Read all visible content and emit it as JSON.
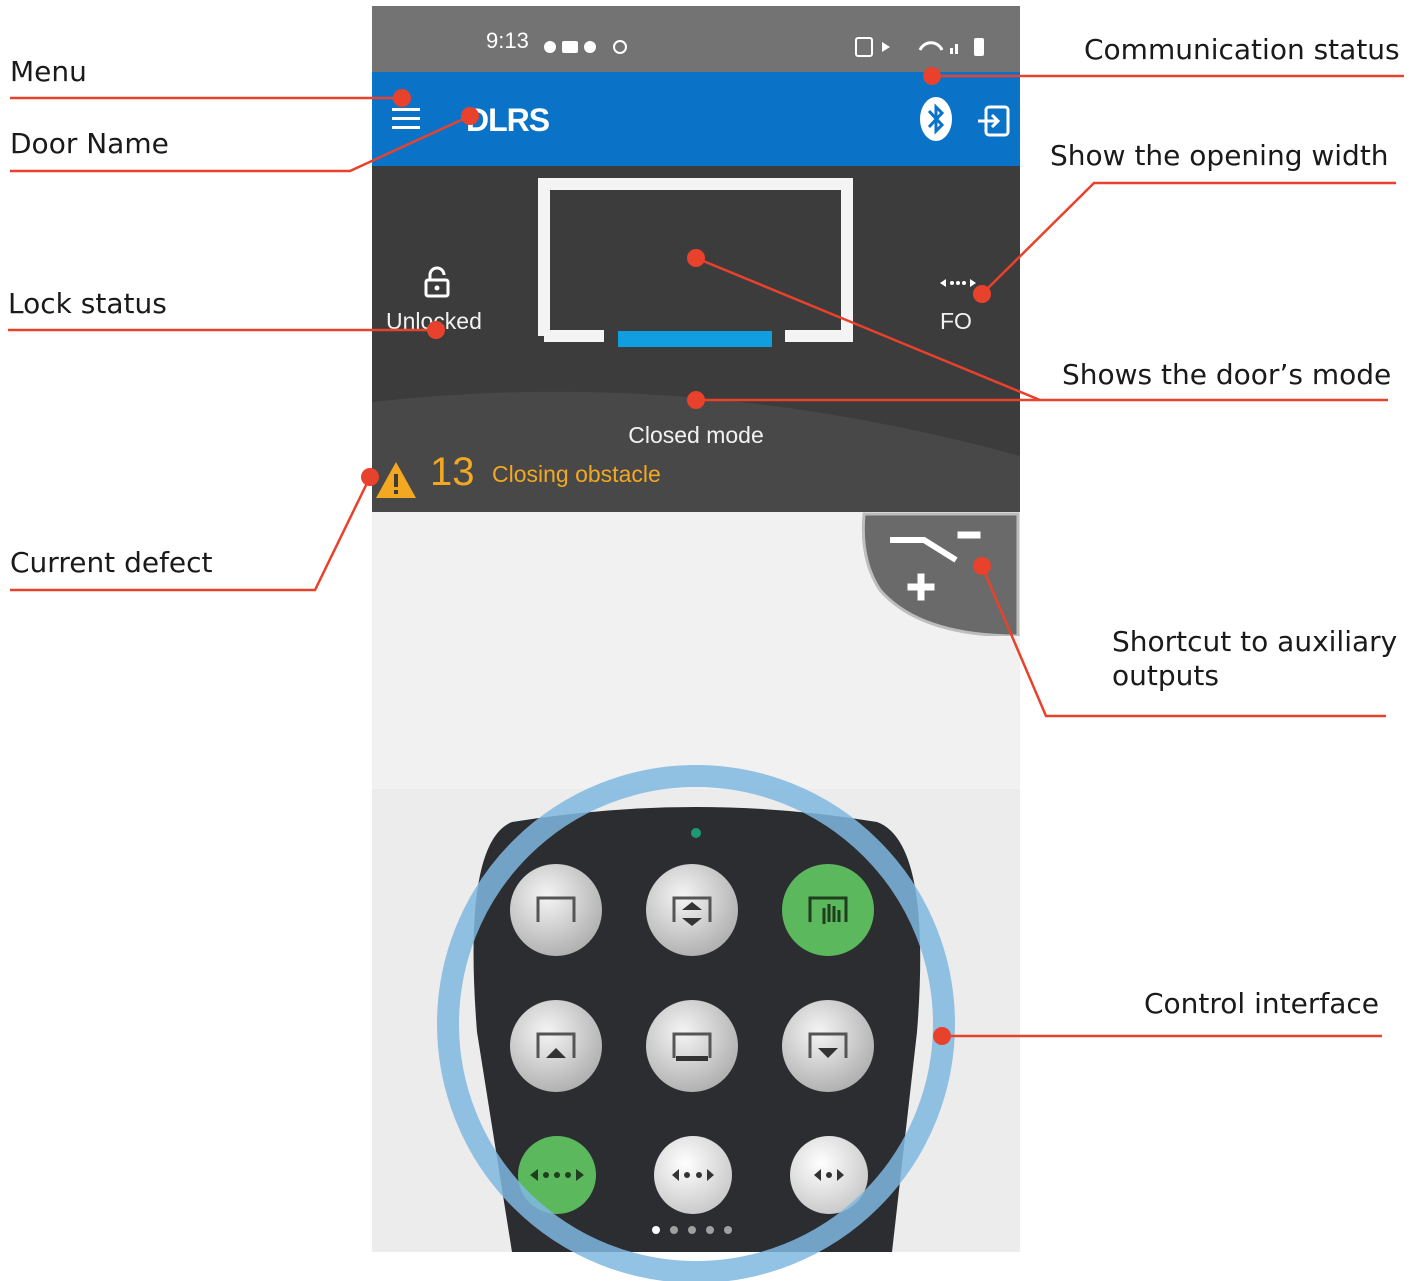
{
  "callouts": {
    "menu": "Menu",
    "door_name": "Door Name",
    "lock_status": "Lock status",
    "current_defect": "Current defect",
    "communication_status": "Communication status",
    "opening_width": "Show the opening width",
    "door_mode": "Shows the door’s mode",
    "aux_shortcut_line1": "Shortcut to auxiliary",
    "aux_shortcut_line2": "outputs",
    "control_interface": "Control interface"
  },
  "phone": {
    "status_bar": {
      "time": "9:13"
    },
    "app_bar": {
      "door_name": "DLRS"
    },
    "lock": {
      "label": "Unlocked"
    },
    "opening_width": {
      "label": "FO"
    },
    "mode": {
      "label": "Closed mode"
    },
    "defect": {
      "code": "13",
      "text": "Closing obstacle"
    }
  },
  "icons": [
    "menu-icon",
    "bluetooth-icon",
    "logout-icon",
    "lock-open-icon",
    "width-arrows-icon",
    "warning-icon",
    "aux-outputs-icon"
  ],
  "colors": {
    "accent_blue": "#0a73c7",
    "callout_red": "#e8412c",
    "warning": "#f3a821",
    "active_green": "#5cb85c",
    "ring_blue": "#7fb8e0"
  }
}
